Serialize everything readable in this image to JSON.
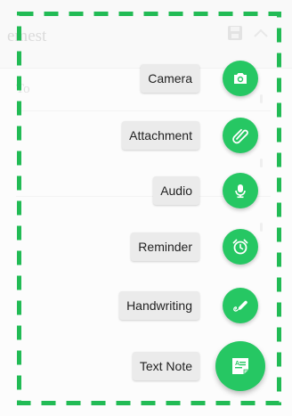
{
  "background": {
    "title": "emest",
    "to_label": "To"
  },
  "colors": {
    "accent": "#26c763",
    "frame": "#22bb55",
    "label_bg": "#ebebeb"
  },
  "fab_menu": {
    "items": [
      {
        "label": "Camera",
        "icon": "camera-icon"
      },
      {
        "label": "Attachment",
        "icon": "paperclip-icon"
      },
      {
        "label": "Audio",
        "icon": "microphone-icon"
      },
      {
        "label": "Reminder",
        "icon": "alarm-clock-icon"
      },
      {
        "label": "Handwriting",
        "icon": "pen-icon"
      }
    ],
    "main": {
      "label": "Text Note",
      "icon": "text-note-icon"
    }
  }
}
